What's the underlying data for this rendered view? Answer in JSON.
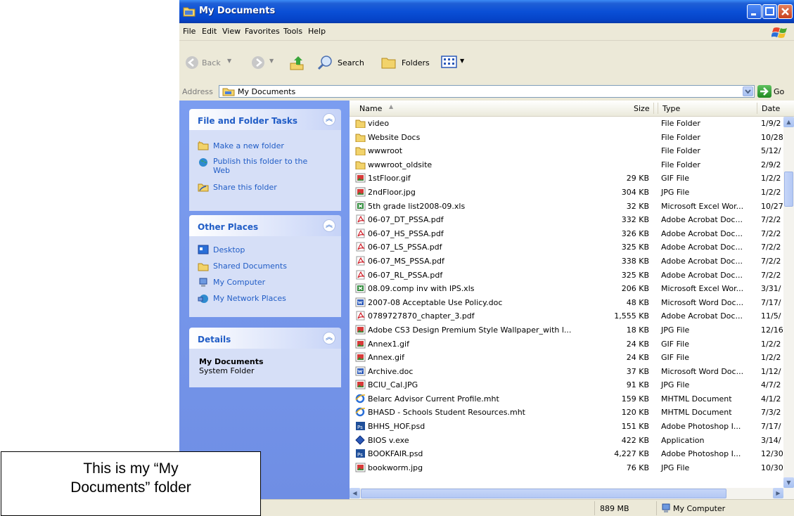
{
  "window": {
    "title": "My Documents"
  },
  "menu": [
    "File",
    "Edit",
    "View",
    "Favorites",
    "Tools",
    "Help"
  ],
  "toolbar": {
    "back": "Back",
    "search": "Search",
    "folders": "Folders"
  },
  "address": {
    "label": "Address",
    "value": "My Documents",
    "go": "Go"
  },
  "tasks": {
    "title": "File and Folder Tasks",
    "items": [
      "Make a new folder",
      "Publish this folder to the Web",
      "Share this folder"
    ]
  },
  "places": {
    "title": "Other Places",
    "items": [
      "Desktop",
      "Shared Documents",
      "My Computer",
      "My Network Places"
    ]
  },
  "details": {
    "title": "Details",
    "name": "My Documents",
    "subtitle": "System Folder"
  },
  "columns": {
    "name": "Name",
    "size": "Size",
    "type": "Type",
    "date": "Date"
  },
  "files": [
    {
      "icon": "folder",
      "name": "video",
      "size": "",
      "type": "File Folder",
      "date": "1/9/2"
    },
    {
      "icon": "folder",
      "name": "Website Docs",
      "size": "",
      "type": "File Folder",
      "date": "10/28"
    },
    {
      "icon": "folder",
      "name": "wwwroot",
      "size": "",
      "type": "File Folder",
      "date": "5/12/"
    },
    {
      "icon": "folder",
      "name": "wwwroot_oldsite",
      "size": "",
      "type": "File Folder",
      "date": "2/9/2"
    },
    {
      "icon": "image",
      "name": "1stFloor.gif",
      "size": "29 KB",
      "type": "GIF File",
      "date": "1/2/2"
    },
    {
      "icon": "image",
      "name": "2ndFloor.jpg",
      "size": "304 KB",
      "type": "JPG File",
      "date": "1/2/2"
    },
    {
      "icon": "excel",
      "name": "5th grade list2008-09.xls",
      "size": "32 KB",
      "type": "Microsoft Excel Wor...",
      "date": "10/27"
    },
    {
      "icon": "pdf",
      "name": "06-07_DT_PSSA.pdf",
      "size": "332 KB",
      "type": "Adobe Acrobat Doc...",
      "date": "7/2/2"
    },
    {
      "icon": "pdf",
      "name": "06-07_HS_PSSA.pdf",
      "size": "326 KB",
      "type": "Adobe Acrobat Doc...",
      "date": "7/2/2"
    },
    {
      "icon": "pdf",
      "name": "06-07_LS_PSSA.pdf",
      "size": "325 KB",
      "type": "Adobe Acrobat Doc...",
      "date": "7/2/2"
    },
    {
      "icon": "pdf",
      "name": "06-07_MS_PSSA.pdf",
      "size": "338 KB",
      "type": "Adobe Acrobat Doc...",
      "date": "7/2/2"
    },
    {
      "icon": "pdf",
      "name": "06-07_RL_PSSA.pdf",
      "size": "325 KB",
      "type": "Adobe Acrobat Doc...",
      "date": "7/2/2"
    },
    {
      "icon": "excel",
      "name": "08.09.comp inv with IPS.xls",
      "size": "206 KB",
      "type": "Microsoft Excel Wor...",
      "date": "3/31/"
    },
    {
      "icon": "word",
      "name": "2007-08 Acceptable Use Policy.doc",
      "size": "48 KB",
      "type": "Microsoft Word Doc...",
      "date": "7/17/"
    },
    {
      "icon": "pdf",
      "name": "0789727870_chapter_3.pdf",
      "size": "1,555 KB",
      "type": "Adobe Acrobat Doc...",
      "date": "11/5/"
    },
    {
      "icon": "image",
      "name": "Adobe CS3 Design Premium Style Wallpaper_with l...",
      "size": "18 KB",
      "type": "JPG File",
      "date": "12/16"
    },
    {
      "icon": "image",
      "name": "Annex1.gif",
      "size": "24 KB",
      "type": "GIF File",
      "date": "1/2/2"
    },
    {
      "icon": "image",
      "name": "Annex.gif",
      "size": "24 KB",
      "type": "GIF File",
      "date": "1/2/2"
    },
    {
      "icon": "word",
      "name": "Archive.doc",
      "size": "37 KB",
      "type": "Microsoft Word Doc...",
      "date": "1/12/"
    },
    {
      "icon": "image",
      "name": "BCIU_Cal.JPG",
      "size": "91 KB",
      "type": "JPG File",
      "date": "4/7/2"
    },
    {
      "icon": "ie",
      "name": "Belarc Advisor Current Profile.mht",
      "size": "159 KB",
      "type": "MHTML Document",
      "date": "4/1/2"
    },
    {
      "icon": "ie",
      "name": "BHASD - Schools  Student Resources.mht",
      "size": "120 KB",
      "type": "MHTML Document",
      "date": "7/3/2"
    },
    {
      "icon": "psd",
      "name": "BHHS_HOF.psd",
      "size": "151 KB",
      "type": "Adobe Photoshop I...",
      "date": "7/17/"
    },
    {
      "icon": "exe",
      "name": "BIOS v.exe",
      "size": "422 KB",
      "type": "Application",
      "date": "3/14/"
    },
    {
      "icon": "psd",
      "name": "BOOKFAIR.psd",
      "size": "4,227 KB",
      "type": "Adobe Photoshop I...",
      "date": "12/30"
    },
    {
      "icon": "image",
      "name": "bookworm.jpg",
      "size": "76 KB",
      "type": "JPG File",
      "date": "10/30"
    }
  ],
  "status": {
    "size": "889 MB",
    "zone": "My Computer"
  },
  "caption": {
    "line1": "This is my “My",
    "line2": "Documents” folder"
  },
  "colors": {
    "title_blue": "#0a4fd6",
    "taskpane_blue": "#7b9df0",
    "link_blue": "#215dc6"
  }
}
